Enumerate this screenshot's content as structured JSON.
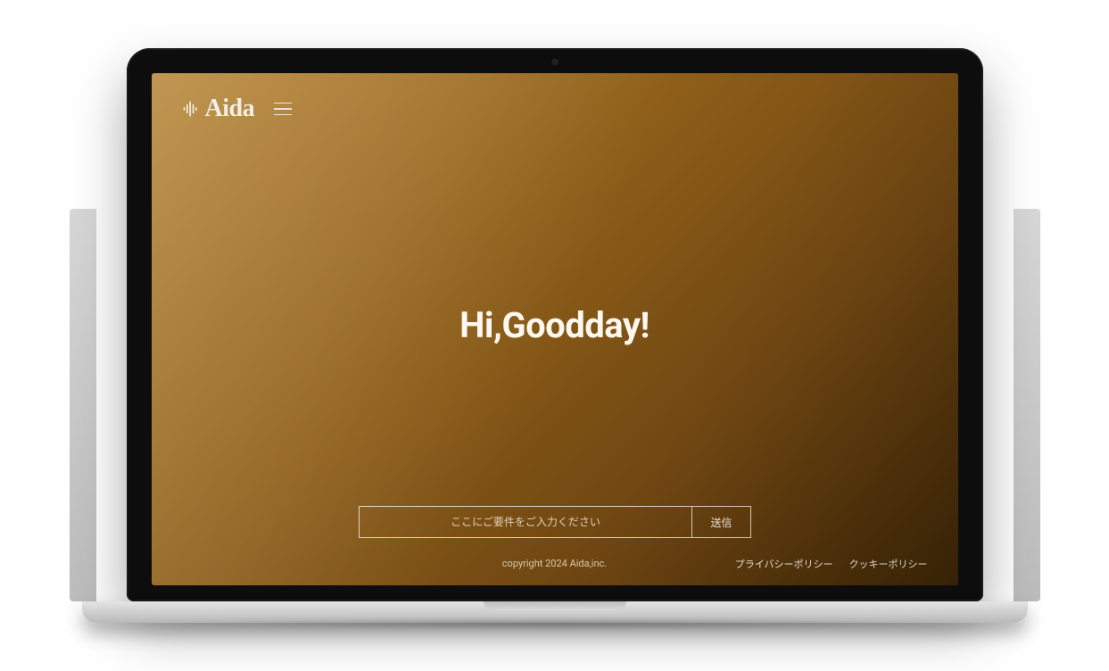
{
  "header": {
    "brand": "Aida"
  },
  "hero": {
    "heading": "Hi,Goodday!"
  },
  "form": {
    "placeholder": "ここにご要件をご入力ください",
    "submit_label": "送信"
  },
  "footer": {
    "copyright": "copyright 2024 Aida,inc.",
    "links": {
      "privacy": "プライバシーポリシー",
      "cookie": "クッキーポリシー"
    }
  }
}
